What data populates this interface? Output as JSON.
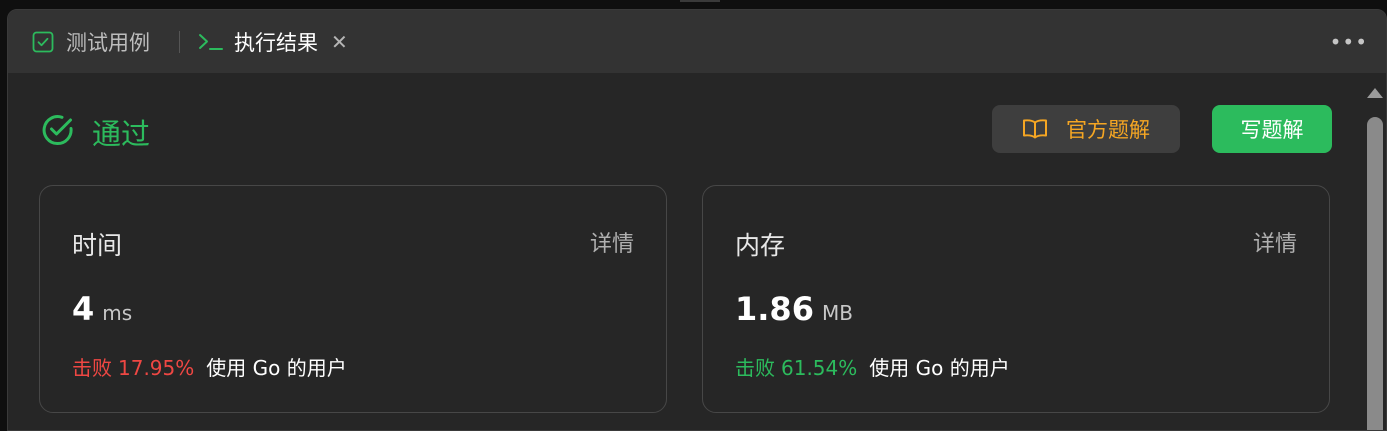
{
  "tabs": [
    {
      "label": "测试用例",
      "icon": "checkbox-icon"
    },
    {
      "label": "执行结果",
      "icon": "terminal-icon"
    }
  ],
  "status": {
    "label": "通过",
    "color": "#2cbb5d"
  },
  "buttons": {
    "official_solution": "官方题解",
    "write_solution": "写题解"
  },
  "cards": [
    {
      "title": "时间",
      "detail": "详情",
      "value": "4",
      "unit": "ms",
      "beat_label": "击败",
      "beat_pct": "17.95%",
      "beat_tail": "使用 Go 的用户",
      "beat_color": "#ef4743"
    },
    {
      "title": "内存",
      "detail": "详情",
      "value": "1.86",
      "unit": "MB",
      "beat_label": "击败",
      "beat_pct": "61.54%",
      "beat_tail": "使用 Go 的用户",
      "beat_color": "#2cbb5d"
    }
  ]
}
